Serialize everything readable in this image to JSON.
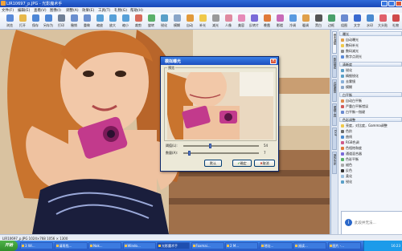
{
  "window": {
    "title": "LIR10697_p.JPG - 光影魔术手"
  },
  "menu": [
    "文件(F)",
    "编辑(E)",
    "查看(V)",
    "图像(I)",
    "调整(A)",
    "效果(E)",
    "工具(T)",
    "礼物(G)",
    "帮助(H)"
  ],
  "toolbar": [
    {
      "label": "浏览",
      "color": "#5a8ad8"
    },
    {
      "label": "打开",
      "color": "#e7b84a"
    },
    {
      "label": "保存",
      "color": "#4c86d6"
    },
    {
      "label": "另存为",
      "color": "#4c86d6"
    },
    {
      "label": "打印",
      "color": "#6f7f95"
    },
    {
      "label": "撤销",
      "color": "#6b8fcf"
    },
    {
      "label": "重做",
      "color": "#6b8fcf"
    },
    {
      "label": "缩放",
      "color": "#57a0d8"
    },
    {
      "label": "放大",
      "color": "#57a0d8"
    },
    {
      "label": "缩小",
      "color": "#57a0d8"
    },
    {
      "label": "裁剪",
      "color": "#d86a5a"
    },
    {
      "label": "旋转",
      "color": "#5bb06a"
    },
    {
      "label": "锐化",
      "color": "#5aa0c8"
    },
    {
      "label": "模糊",
      "color": "#8aa6c8"
    },
    {
      "label": "自动",
      "color": "#e29a3a"
    },
    {
      "label": "补光",
      "color": "#f0c94a"
    },
    {
      "label": "减光",
      "color": "#9a9a9a"
    },
    {
      "label": "人像",
      "color": "#e08aa0"
    },
    {
      "label": "美容",
      "color": "#e68ab8"
    },
    {
      "label": "反转片",
      "color": "#7a6ad8"
    },
    {
      "label": "晚霞",
      "color": "#e07a3a"
    },
    {
      "label": "影楼",
      "color": "#c86ab8"
    },
    {
      "label": "冷调",
      "color": "#5a9ae0"
    },
    {
      "label": "暖调",
      "color": "#e0a04a"
    },
    {
      "label": "黑白",
      "color": "#555555"
    },
    {
      "label": "边框",
      "color": "#4aa06a"
    },
    {
      "label": "组图",
      "color": "#6a8ad0"
    },
    {
      "label": "文字",
      "color": "#3a6ad0"
    },
    {
      "label": "水印",
      "color": "#4a8ad0"
    },
    {
      "label": "大头贴",
      "color": "#e0606a"
    },
    {
      "label": "礼物",
      "color": "#d04a4a"
    }
  ],
  "panel": {
    "tabs": [
      "基本调整",
      "数码暗房",
      "边框图层",
      "便捷工具",
      "EXIF",
      "操作历史"
    ],
    "sections": [
      {
        "title": "曝光",
        "items": [
          {
            "label": "自动曝光",
            "color": "#e0a04a"
          },
          {
            "label": "数码补光",
            "color": "#f0c94a"
          },
          {
            "label": "数码减光",
            "color": "#8a8a8a"
          },
          {
            "label": "数字点测光",
            "color": "#5a8ad8"
          }
        ]
      },
      {
        "title": "清晰度",
        "items": [
          {
            "label": "锐化",
            "color": "#5aa0c8"
          },
          {
            "label": "精细锐化",
            "color": "#5aa0c8"
          },
          {
            "label": "去雾镜",
            "color": "#8ab0d8"
          },
          {
            "label": "模糊",
            "color": "#8aa6c8"
          }
        ]
      },
      {
        "title": "白平衡",
        "items": [
          {
            "label": "自动白平衡",
            "color": "#e08a4a"
          },
          {
            "label": "严重白平衡错误",
            "color": "#d05a5a"
          },
          {
            "label": "白平衡一指键",
            "color": "#6a8ad0"
          }
        ]
      },
      {
        "title": "色彩调整",
        "items": [
          {
            "label": "亮度，对比度，Gamma调整",
            "color": "#f0c94a"
          },
          {
            "label": "色阶",
            "color": "#6a6a6a"
          },
          {
            "label": "曲线",
            "color": "#4a8ad0"
          },
          {
            "label": "RGB色调",
            "color": "#d05a8a"
          },
          {
            "label": "色相饱和度",
            "color": "#e07a3a"
          },
          {
            "label": "通道混合器",
            "color": "#7a6ad8"
          },
          {
            "label": "色彩平衡",
            "color": "#5ab06a"
          },
          {
            "label": "褪色",
            "color": "#aaaaaa"
          },
          {
            "label": "反色",
            "color": "#333333"
          },
          {
            "label": "柔化",
            "color": "#9ac0e0"
          },
          {
            "label": "锐化",
            "color": "#5aa0c8"
          }
        ]
      }
    ],
    "help_text": "此段并无法..."
  },
  "dialog": {
    "title": "模拟曝光",
    "preview_label": "预览",
    "sliders": [
      {
        "label": "阈值(L):",
        "value": "54",
        "fraction": 0.35
      },
      {
        "label": "数量(A):",
        "value": "7",
        "fraction": 0.07
      }
    ],
    "buttons": {
      "default": "默认",
      "ok": "确定",
      "cancel": "取消"
    }
  },
  "status": {
    "text": "LIR10697_p.JPG    1024×768    1056 × 1300"
  },
  "taskbar": {
    "start": "开始",
    "tasks": [
      "3 Wi...",
      "请再找...",
      "Nok...",
      "Windo...",
      "光影魔术手",
      "Foxmai...",
      "2 M...",
      "地址...",
      "阅读...",
      "图片 -..."
    ],
    "clock": "16:23"
  }
}
